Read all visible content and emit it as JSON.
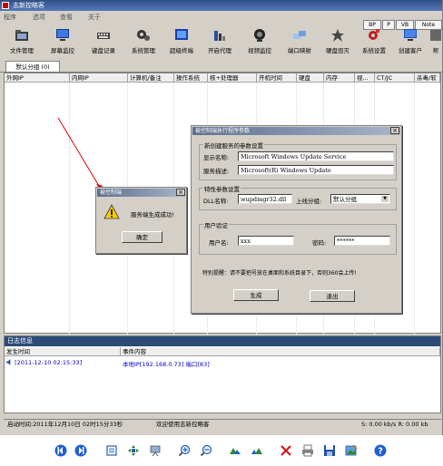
{
  "window": {
    "title": "志新控略客"
  },
  "menu": [
    "程序",
    "选项",
    "查看",
    "关于"
  ],
  "side_buttons": [
    "BP",
    "P",
    "VB",
    "Note"
  ],
  "toolbar": [
    {
      "label": "文件管理",
      "icon": "folder-icon"
    },
    {
      "label": "屏幕监控",
      "icon": "monitor-icon"
    },
    {
      "label": "键盘记录",
      "icon": "keyboard-icon"
    },
    {
      "label": "系统管理",
      "icon": "gears-icon"
    },
    {
      "label": "超级终端",
      "icon": "terminal-icon"
    },
    {
      "label": "开启代理",
      "icon": "proxy-icon"
    },
    {
      "label": "视频监控",
      "icon": "webcam-icon"
    },
    {
      "label": "端口映射",
      "icon": "port-icon"
    },
    {
      "label": "硬盘毁灭",
      "icon": "disk-icon"
    },
    {
      "label": "系统设置",
      "icon": "settings-icon"
    },
    {
      "label": "创建客户",
      "icon": "create-client-icon"
    },
    {
      "label": "帮",
      "icon": "help-icon"
    }
  ],
  "tab": {
    "label": "默认分组 (0)"
  },
  "grid": {
    "headers": [
      "外网IP",
      "内网IP",
      "计算机/备注",
      "操作系统",
      "核+处理器",
      "开机时间",
      "硬盘",
      "内存",
      "视...",
      "CT/JC",
      "杀毒/软"
    ]
  },
  "config_dialog": {
    "title": "被控制端执行程序参数",
    "group1": "新创建服务的参数设置",
    "display_name_label": "显示名称:",
    "display_name_value": "Microsoft Windows Update Service",
    "service_desc_label": "服务描述:",
    "service_desc_value": "Microsoft(R) Windows Update",
    "group2": "特性参数设置",
    "dll_label": "DLL名称:",
    "dll_value": "wupdmgr32.dll",
    "group_label": "上线分组:",
    "group_value": "默认分组",
    "group3": "用户验证",
    "user_label": "用户名:",
    "user_value": "xxx",
    "pass_label": "密码:",
    "pass_value": "******",
    "note": "特别提醒：请不要把号放在桌面和系统目录下，否则360会上传!",
    "generate": "生成",
    "exit": "退出"
  },
  "msg_dialog": {
    "title": "被控制端",
    "message": "服务端生成成功!",
    "ok": "确定"
  },
  "log": {
    "title": "日志信息",
    "col_time": "发生时间",
    "col_content": "事件内容",
    "row_time": "[2011-12-10 02:15:33]",
    "row_content": "本地IP[192.168.0.73] 端口[83]"
  },
  "status": {
    "start_time": "启动时间:2011年12月10日 02时15分33秒",
    "welcome": "欢迎使用志新控略客",
    "speed": "S: 0.00 kb/s R: 0.00 kb"
  }
}
